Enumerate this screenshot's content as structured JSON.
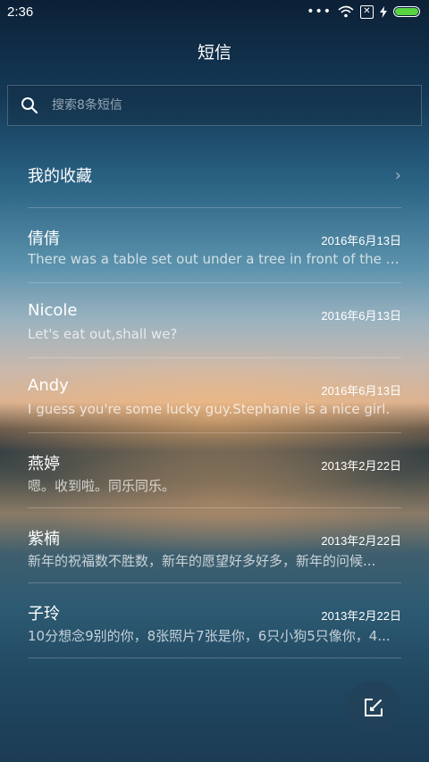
{
  "status_bar": {
    "time": "2:36",
    "dots": "•••",
    "battery_level": 1.0
  },
  "header": {
    "title": "短信"
  },
  "search": {
    "placeholder": "搜索8条短信"
  },
  "favorites": {
    "label": "我的收藏"
  },
  "threads": [
    {
      "name": "倩倩",
      "date": "2016年6月13日",
      "preview": "There was a table set out under a tree in front of the ho..."
    },
    {
      "name": "Nicole",
      "date": "2016年6月13日",
      "preview": "Let's eat out,shall we?"
    },
    {
      "name": "Andy",
      "date": "2016年6月13日",
      "preview": "I guess you're some lucky guy.Stephanie is a nice girl."
    },
    {
      "name": "燕婷",
      "date": "2013年2月22日",
      "preview": "嗯。收到啦。同乐同乐。"
    },
    {
      "name": "紫楠",
      "date": "2013年2月22日",
      "preview": "新年的祝福数不胜数，新年的愿望好多好多，新年的问候..."
    },
    {
      "name": "子玲",
      "date": "2013年2月22日",
      "preview": "10分想念9别的你，8张照片7张是你，6只小狗5只像你，4..."
    }
  ],
  "icons": {
    "search": "search-icon",
    "chevron": "chevron-right-icon",
    "compose": "compose-icon",
    "wifi": "wifi-icon",
    "signal": "signal-icon",
    "battery": "battery-icon"
  },
  "colors": {
    "battery_fill": "#58d341"
  }
}
